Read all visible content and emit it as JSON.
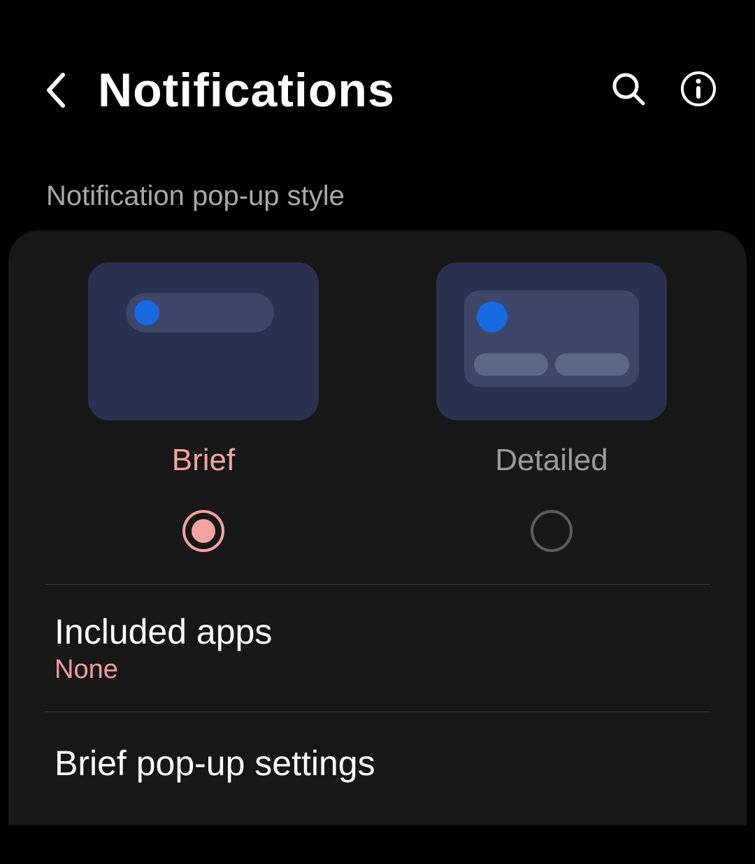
{
  "header": {
    "title": "Notifications"
  },
  "section": {
    "popup_style_header": "Notification pop-up style"
  },
  "style_options": {
    "brief": {
      "label": "Brief",
      "selected": true
    },
    "detailed": {
      "label": "Detailed",
      "selected": false
    }
  },
  "included_apps": {
    "title": "Included apps",
    "value": "None"
  },
  "brief_popup": {
    "title": "Brief pop-up settings"
  },
  "colors": {
    "accent": "#f5a3a0",
    "background": "#000000",
    "card": "#171717"
  }
}
